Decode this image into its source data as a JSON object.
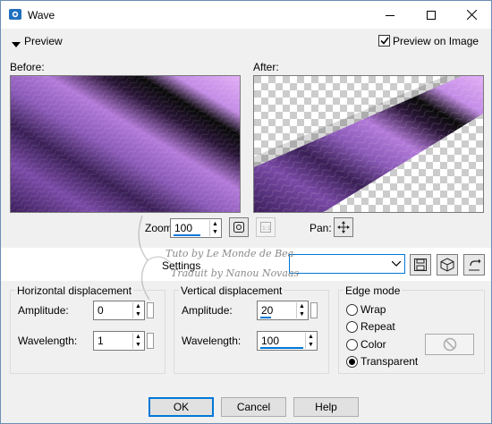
{
  "window": {
    "title": "Wave"
  },
  "preview_bar": {
    "toggle_label": "Preview",
    "preview_on_image_label": "Preview on Image",
    "preview_on_image_checked": true
  },
  "panels": {
    "before_label": "Before:",
    "after_label": "After:"
  },
  "zoom": {
    "label": "Zoom:",
    "value": "100",
    "pan_label": "Pan:"
  },
  "settings": {
    "label": "Settings",
    "selected": ""
  },
  "watermark": {
    "line1": "Tuto by Le Monde de Bea",
    "line2": "Traduit by Nanou Novaas"
  },
  "horizontal": {
    "title": "Horizontal displacement",
    "amplitude_label": "Amplitude:",
    "amplitude": "0",
    "wavelength_label": "Wavelength:",
    "wavelength": "1"
  },
  "vertical": {
    "title": "Vertical displacement",
    "amplitude_label": "Amplitude:",
    "amplitude": "20",
    "wavelength_label": "Wavelength:",
    "wavelength": "100"
  },
  "edge_mode": {
    "title": "Edge mode",
    "options": [
      "Wrap",
      "Repeat",
      "Color",
      "Transparent"
    ],
    "selected": "Transparent"
  },
  "buttons": {
    "ok": "OK",
    "cancel": "Cancel",
    "help": "Help"
  },
  "colors": {
    "accent": "#0078d7",
    "purple_dark": "#2a1448",
    "purple_light": "#c58ee8",
    "background": "#f0f0f0"
  }
}
